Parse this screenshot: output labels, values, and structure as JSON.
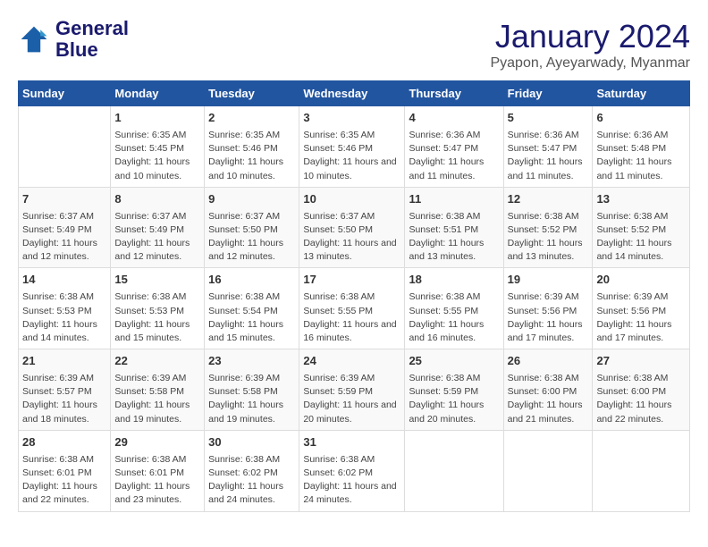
{
  "header": {
    "logo_line1": "General",
    "logo_line2": "Blue",
    "main_title": "January 2024",
    "subtitle": "Pyapon, Ayeyarwady, Myanmar"
  },
  "days_of_week": [
    "Sunday",
    "Monday",
    "Tuesday",
    "Wednesday",
    "Thursday",
    "Friday",
    "Saturday"
  ],
  "weeks": [
    [
      {
        "day": "",
        "sunrise": "",
        "sunset": "",
        "daylight": ""
      },
      {
        "day": "1",
        "sunrise": "Sunrise: 6:35 AM",
        "sunset": "Sunset: 5:45 PM",
        "daylight": "Daylight: 11 hours and 10 minutes."
      },
      {
        "day": "2",
        "sunrise": "Sunrise: 6:35 AM",
        "sunset": "Sunset: 5:46 PM",
        "daylight": "Daylight: 11 hours and 10 minutes."
      },
      {
        "day": "3",
        "sunrise": "Sunrise: 6:35 AM",
        "sunset": "Sunset: 5:46 PM",
        "daylight": "Daylight: 11 hours and 10 minutes."
      },
      {
        "day": "4",
        "sunrise": "Sunrise: 6:36 AM",
        "sunset": "Sunset: 5:47 PM",
        "daylight": "Daylight: 11 hours and 11 minutes."
      },
      {
        "day": "5",
        "sunrise": "Sunrise: 6:36 AM",
        "sunset": "Sunset: 5:47 PM",
        "daylight": "Daylight: 11 hours and 11 minutes."
      },
      {
        "day": "6",
        "sunrise": "Sunrise: 6:36 AM",
        "sunset": "Sunset: 5:48 PM",
        "daylight": "Daylight: 11 hours and 11 minutes."
      }
    ],
    [
      {
        "day": "7",
        "sunrise": "Sunrise: 6:37 AM",
        "sunset": "Sunset: 5:49 PM",
        "daylight": "Daylight: 11 hours and 12 minutes."
      },
      {
        "day": "8",
        "sunrise": "Sunrise: 6:37 AM",
        "sunset": "Sunset: 5:49 PM",
        "daylight": "Daylight: 11 hours and 12 minutes."
      },
      {
        "day": "9",
        "sunrise": "Sunrise: 6:37 AM",
        "sunset": "Sunset: 5:50 PM",
        "daylight": "Daylight: 11 hours and 12 minutes."
      },
      {
        "day": "10",
        "sunrise": "Sunrise: 6:37 AM",
        "sunset": "Sunset: 5:50 PM",
        "daylight": "Daylight: 11 hours and 13 minutes."
      },
      {
        "day": "11",
        "sunrise": "Sunrise: 6:38 AM",
        "sunset": "Sunset: 5:51 PM",
        "daylight": "Daylight: 11 hours and 13 minutes."
      },
      {
        "day": "12",
        "sunrise": "Sunrise: 6:38 AM",
        "sunset": "Sunset: 5:52 PM",
        "daylight": "Daylight: 11 hours and 13 minutes."
      },
      {
        "day": "13",
        "sunrise": "Sunrise: 6:38 AM",
        "sunset": "Sunset: 5:52 PM",
        "daylight": "Daylight: 11 hours and 14 minutes."
      }
    ],
    [
      {
        "day": "14",
        "sunrise": "Sunrise: 6:38 AM",
        "sunset": "Sunset: 5:53 PM",
        "daylight": "Daylight: 11 hours and 14 minutes."
      },
      {
        "day": "15",
        "sunrise": "Sunrise: 6:38 AM",
        "sunset": "Sunset: 5:53 PM",
        "daylight": "Daylight: 11 hours and 15 minutes."
      },
      {
        "day": "16",
        "sunrise": "Sunrise: 6:38 AM",
        "sunset": "Sunset: 5:54 PM",
        "daylight": "Daylight: 11 hours and 15 minutes."
      },
      {
        "day": "17",
        "sunrise": "Sunrise: 6:38 AM",
        "sunset": "Sunset: 5:55 PM",
        "daylight": "Daylight: 11 hours and 16 minutes."
      },
      {
        "day": "18",
        "sunrise": "Sunrise: 6:38 AM",
        "sunset": "Sunset: 5:55 PM",
        "daylight": "Daylight: 11 hours and 16 minutes."
      },
      {
        "day": "19",
        "sunrise": "Sunrise: 6:39 AM",
        "sunset": "Sunset: 5:56 PM",
        "daylight": "Daylight: 11 hours and 17 minutes."
      },
      {
        "day": "20",
        "sunrise": "Sunrise: 6:39 AM",
        "sunset": "Sunset: 5:56 PM",
        "daylight": "Daylight: 11 hours and 17 minutes."
      }
    ],
    [
      {
        "day": "21",
        "sunrise": "Sunrise: 6:39 AM",
        "sunset": "Sunset: 5:57 PM",
        "daylight": "Daylight: 11 hours and 18 minutes."
      },
      {
        "day": "22",
        "sunrise": "Sunrise: 6:39 AM",
        "sunset": "Sunset: 5:58 PM",
        "daylight": "Daylight: 11 hours and 19 minutes."
      },
      {
        "day": "23",
        "sunrise": "Sunrise: 6:39 AM",
        "sunset": "Sunset: 5:58 PM",
        "daylight": "Daylight: 11 hours and 19 minutes."
      },
      {
        "day": "24",
        "sunrise": "Sunrise: 6:39 AM",
        "sunset": "Sunset: 5:59 PM",
        "daylight": "Daylight: 11 hours and 20 minutes."
      },
      {
        "day": "25",
        "sunrise": "Sunrise: 6:38 AM",
        "sunset": "Sunset: 5:59 PM",
        "daylight": "Daylight: 11 hours and 20 minutes."
      },
      {
        "day": "26",
        "sunrise": "Sunrise: 6:38 AM",
        "sunset": "Sunset: 6:00 PM",
        "daylight": "Daylight: 11 hours and 21 minutes."
      },
      {
        "day": "27",
        "sunrise": "Sunrise: 6:38 AM",
        "sunset": "Sunset: 6:00 PM",
        "daylight": "Daylight: 11 hours and 22 minutes."
      }
    ],
    [
      {
        "day": "28",
        "sunrise": "Sunrise: 6:38 AM",
        "sunset": "Sunset: 6:01 PM",
        "daylight": "Daylight: 11 hours and 22 minutes."
      },
      {
        "day": "29",
        "sunrise": "Sunrise: 6:38 AM",
        "sunset": "Sunset: 6:01 PM",
        "daylight": "Daylight: 11 hours and 23 minutes."
      },
      {
        "day": "30",
        "sunrise": "Sunrise: 6:38 AM",
        "sunset": "Sunset: 6:02 PM",
        "daylight": "Daylight: 11 hours and 24 minutes."
      },
      {
        "day": "31",
        "sunrise": "Sunrise: 6:38 AM",
        "sunset": "Sunset: 6:02 PM",
        "daylight": "Daylight: 11 hours and 24 minutes."
      },
      {
        "day": "",
        "sunrise": "",
        "sunset": "",
        "daylight": ""
      },
      {
        "day": "",
        "sunrise": "",
        "sunset": "",
        "daylight": ""
      },
      {
        "day": "",
        "sunrise": "",
        "sunset": "",
        "daylight": ""
      }
    ]
  ]
}
